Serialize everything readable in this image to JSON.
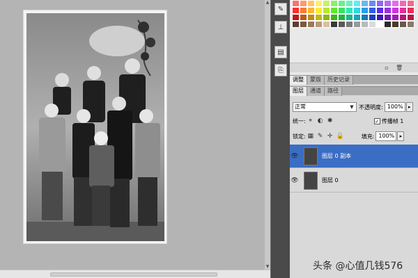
{
  "palette": {
    "swatch_colors": [
      "#ff6f6f",
      "#ff9a6a",
      "#ffc46a",
      "#fff06a",
      "#c8f06a",
      "#8af06a",
      "#6af08a",
      "#6af0c8",
      "#6ae8f0",
      "#6ab8f0",
      "#6a8af0",
      "#8a6af0",
      "#b86af0",
      "#e86af0",
      "#f06ab8",
      "#f06a8a",
      "#ff2e2e",
      "#ff7a2e",
      "#ffb52e",
      "#ffe92e",
      "#b5e92e",
      "#5ee92e",
      "#2ee95e",
      "#2ee9b5",
      "#2ed8e9",
      "#2e9be9",
      "#2e5ee9",
      "#5e2ee9",
      "#9b2ee9",
      "#d82ee9",
      "#e92e9b",
      "#e92e5e",
      "#c01818",
      "#c05a18",
      "#c08c18",
      "#c0b818",
      "#8cb818",
      "#3cb818",
      "#18b83c",
      "#18b88c",
      "#18a8b8",
      "#1878b8",
      "#1840b8",
      "#4018b8",
      "#7818b8",
      "#a818b8",
      "#b81878",
      "#b81840",
      "#5a4030",
      "#7a5a40",
      "#9a7a5a",
      "#b89a7a",
      "#d8c0a0",
      "#3a3a3a",
      "#5a5a5a",
      "#7a7a7a",
      "#9a9a9a",
      "#bababa",
      "#dadada",
      "#ffffff",
      "#2a2a2a",
      "#4a3a2a",
      "#6a5a4a",
      "#8a7a6a"
    ]
  },
  "tabs_top": [
    "调整",
    "蒙版",
    "历史记录"
  ],
  "tabs_layers": [
    "图层",
    "通道",
    "路径"
  ],
  "layers_panel": {
    "blend_mode": "正常",
    "opacity_label": "不透明度:",
    "opacity_value": "100%",
    "unify_label": "统一:",
    "propagate_label": "传播帧 1",
    "lock_label": "锁定:",
    "fill_label": "填充:",
    "fill_value": "100%",
    "layers": [
      {
        "name": "图层 0 副本",
        "selected": true
      },
      {
        "name": "图层 0",
        "selected": false
      }
    ]
  },
  "watermark": "头条 @心值几钱576"
}
